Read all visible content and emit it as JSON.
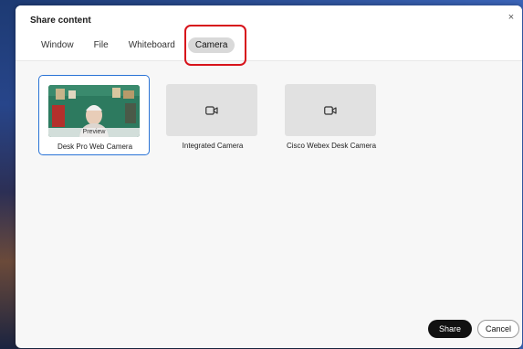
{
  "dialog": {
    "title": "Share content",
    "close_glyph": "×"
  },
  "tabs": [
    {
      "label": "Window",
      "active": false
    },
    {
      "label": "File",
      "active": false
    },
    {
      "label": "Whiteboard",
      "active": false
    },
    {
      "label": "Camera",
      "active": true
    }
  ],
  "cameras": [
    {
      "name": "Desk Pro Web Camera",
      "selected": true,
      "preview_label": "Preview",
      "icon": "webcam-preview-image"
    },
    {
      "name": "Integrated Camera",
      "selected": false,
      "icon": "video-camera-icon"
    },
    {
      "name": "Cisco Webex Desk Camera",
      "selected": false,
      "icon": "video-camera-icon"
    }
  ],
  "footer": {
    "share_label": "Share",
    "cancel_label": "Cancel"
  },
  "colors": {
    "highlight": "#d7131b",
    "selected_border": "#2a73d6",
    "primary_button": "#111111"
  }
}
